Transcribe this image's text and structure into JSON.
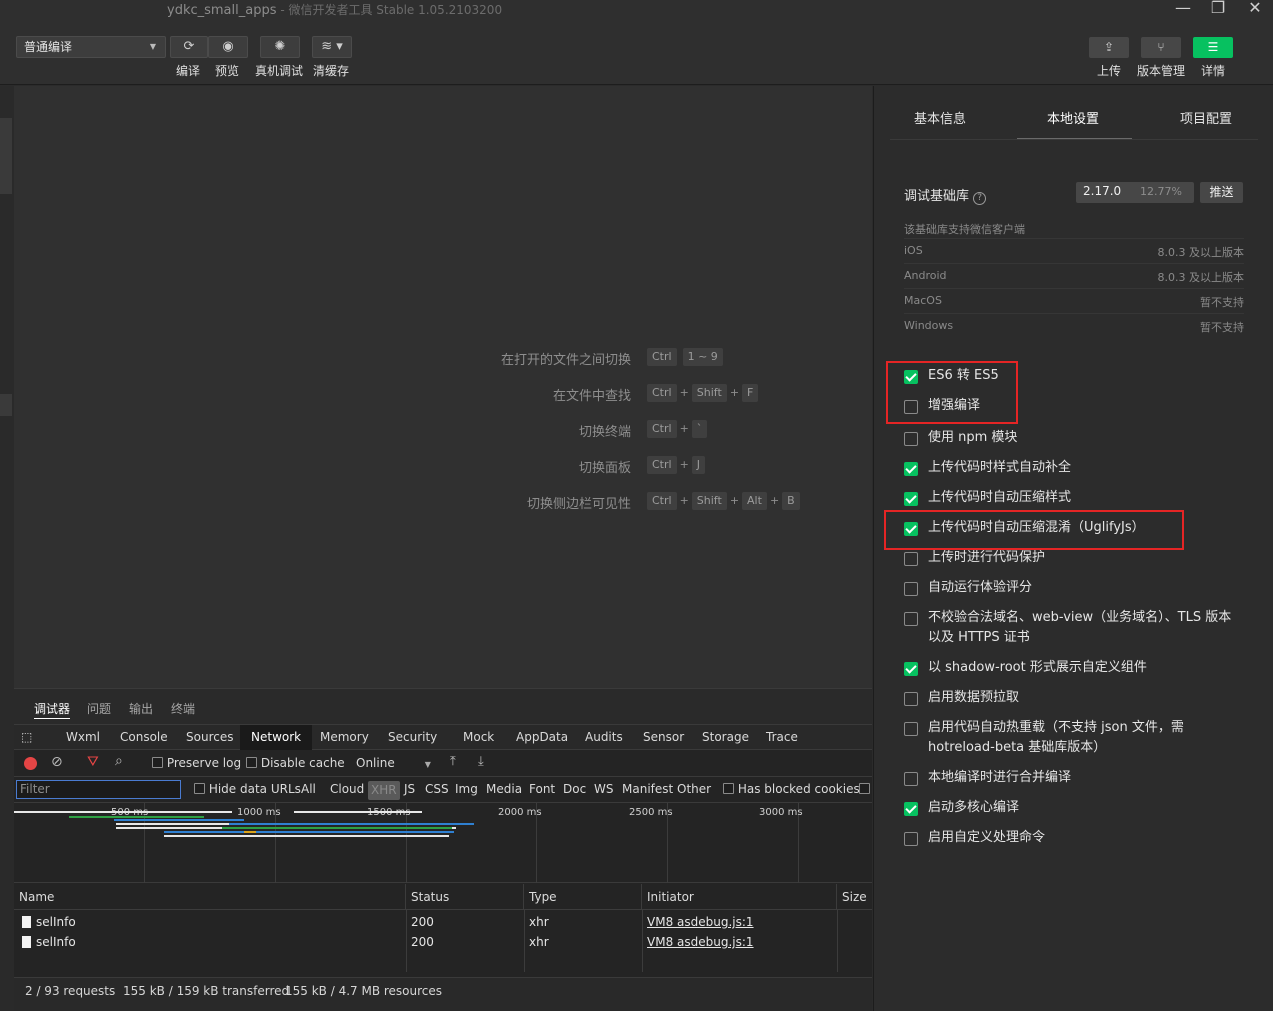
{
  "window": {
    "title": "ydkc_small_apps",
    "subtitle": " - 微信开发者工具 Stable 1.05.2103200"
  },
  "toolbar": {
    "compile_mode": "普通编译",
    "compile_label": "编译",
    "preview_label": "预览",
    "remote_debug_label": "真机调试",
    "clear_cache_label": "清缓存",
    "upload_label": "上传",
    "version_label": "版本管理",
    "detail_label": "详情"
  },
  "editor": {
    "shortcuts": [
      {
        "label": "在打开的文件之间切换",
        "keys": [
          "Ctrl",
          "1 ~ 9"
        ],
        "sep": [
          ""
        ]
      },
      {
        "label": "在文件中查找",
        "keys": [
          "Ctrl",
          "Shift",
          "F"
        ],
        "sep": [
          "+",
          "+"
        ]
      },
      {
        "label": "切换终端",
        "keys": [
          "Ctrl",
          "`"
        ],
        "sep": [
          "+"
        ]
      },
      {
        "label": "切换面板",
        "keys": [
          "Ctrl",
          "J"
        ],
        "sep": [
          "+"
        ]
      },
      {
        "label": "切换侧边栏可见性",
        "keys": [
          "Ctrl",
          "Shift",
          "Alt",
          "B"
        ],
        "sep": [
          "+",
          "+",
          "+"
        ]
      }
    ]
  },
  "devtools": {
    "top_tabs": [
      "调试器",
      "问题",
      "输出",
      "终端"
    ],
    "panel_tabs": [
      "Wxml",
      "Console",
      "Sources",
      "Network",
      "Memory",
      "Security",
      "Mock",
      "AppData",
      "Audits",
      "Sensor",
      "Storage",
      "Trace"
    ],
    "active_panel": "Network",
    "toolbar": {
      "preserve_log": "Preserve log",
      "disable_cache": "Disable cache",
      "throttle": "Online"
    },
    "filter": {
      "placeholder": "Filter",
      "hide_data_urls": "Hide data URLs",
      "types": [
        "All",
        "Cloud",
        "XHR",
        "JS",
        "CSS",
        "Img",
        "Media",
        "Font",
        "Doc",
        "WS",
        "Manifest",
        "Other"
      ],
      "active_type": "XHR",
      "blocked_cookies": "Has blocked cookies"
    },
    "overview_ticks": [
      "500 ms",
      "1000 ms",
      "1500 ms",
      "2000 ms",
      "2500 ms",
      "3000 ms"
    ],
    "table": {
      "columns": [
        "Name",
        "Status",
        "Type",
        "Initiator",
        "Size"
      ],
      "rows": [
        {
          "name": "selInfo",
          "status": "200",
          "type": "xhr",
          "initiator": "VM8 asdebug.js:1"
        },
        {
          "name": "selInfo",
          "status": "200",
          "type": "xhr",
          "initiator": "VM8 asdebug.js:1"
        }
      ]
    },
    "status_bar": {
      "requests": "2 / 93 requests",
      "transferred": "155 kB / 159 kB transferred",
      "resources": "155 kB / 4.7 MB resources"
    }
  },
  "settings": {
    "tabs": [
      "基本信息",
      "本地设置",
      "项目配置"
    ],
    "active_tab": "本地设置",
    "base_lib_label": "调试基础库",
    "base_lib_version": "2.17.0",
    "base_lib_percent": "12.77%",
    "push_label": "推送",
    "support_header": "该基础库支持微信客户端",
    "support": [
      {
        "platform": "iOS",
        "value": "8.0.3 及以上版本"
      },
      {
        "platform": "Android",
        "value": "8.0.3 及以上版本"
      },
      {
        "platform": "MacOS",
        "value": "暂不支持"
      },
      {
        "platform": "Windows",
        "value": "暂不支持"
      }
    ],
    "options": [
      {
        "label": "ES6 转 ES5",
        "checked": true
      },
      {
        "label": "增强编译",
        "checked": false
      },
      {
        "label": "使用 npm 模块",
        "checked": false
      },
      {
        "label": "上传代码时样式自动补全",
        "checked": true
      },
      {
        "label": "上传代码时自动压缩样式",
        "checked": true
      },
      {
        "label": "上传代码时自动压缩混淆（UglifyJs）",
        "checked": true
      },
      {
        "label": "上传时进行代码保护",
        "checked": false
      },
      {
        "label": "自动运行体验评分",
        "checked": false
      },
      {
        "label": "不校验合法域名、web-view（业务域名）、TLS 版本以及 HTTPS 证书",
        "checked": false
      },
      {
        "label": "以 shadow-root 形式展示自定义组件",
        "checked": true
      },
      {
        "label": "启用数据预拉取",
        "checked": false
      },
      {
        "label": "启用代码自动热重载（不支持 json 文件，需 hotreload-beta 基础库版本）",
        "checked": false
      },
      {
        "label": "本地编译时进行合并编译",
        "checked": false
      },
      {
        "label": "启动多核心编译",
        "checked": true
      },
      {
        "label": "启用自定义处理命令",
        "checked": false
      }
    ]
  },
  "colors": {
    "accent_green": "#07c160",
    "highlight_red": "#e52525"
  }
}
